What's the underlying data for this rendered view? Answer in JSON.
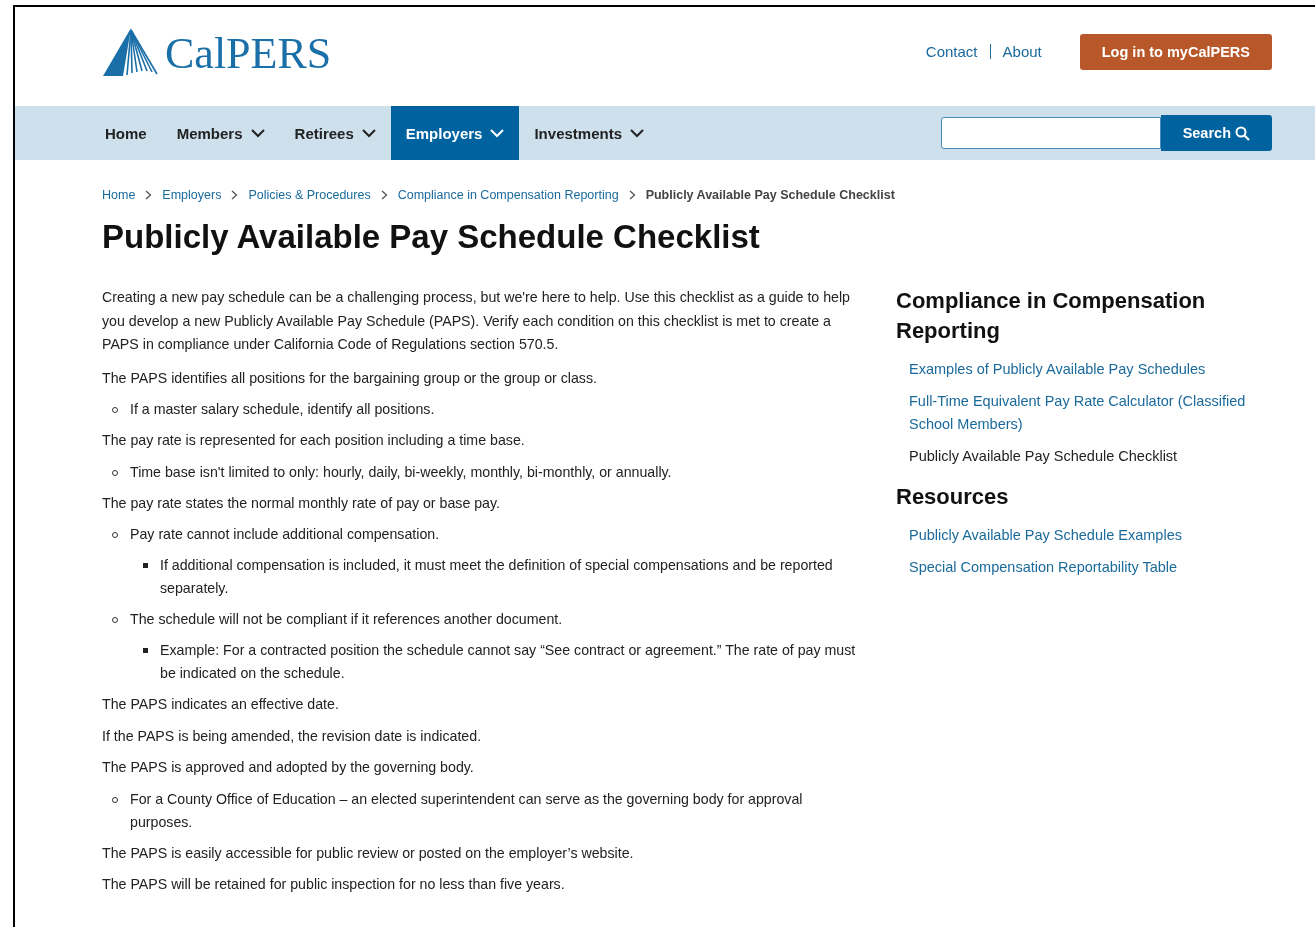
{
  "header": {
    "logo": "CalPERS",
    "links": [
      "Contact",
      "About"
    ],
    "login_button": "Log in to myCalPERS"
  },
  "nav": {
    "items": [
      {
        "label": "Home",
        "dropdown": false,
        "selected": false
      },
      {
        "label": "Members",
        "dropdown": true,
        "selected": false
      },
      {
        "label": "Retirees",
        "dropdown": true,
        "selected": false
      },
      {
        "label": "Employers",
        "dropdown": true,
        "selected": true
      },
      {
        "label": "Investments",
        "dropdown": true,
        "selected": false
      }
    ],
    "search": {
      "button": "Search"
    }
  },
  "breadcrumb": [
    "Home",
    "Employers",
    "Policies & Procedures",
    "Compliance in Compensation Reporting",
    "Publicly Available Pay Schedule Checklist"
  ],
  "title": "Publicly Available Pay Schedule Checklist",
  "intro": "Creating a new pay schedule can be a challenging process, but we're here to help. Use this checklist as a guide to help you develop a new Publicly Available Pay Schedule (PAPS). Verify each condition on this checklist is met to create a PAPS in compliance under California Code of Regulations section 570.5.",
  "checklist": [
    {
      "text": "The PAPS identifies all positions for the bargaining group or the group or class.",
      "children": [
        {
          "text": "If a master salary schedule, identify all positions."
        }
      ]
    },
    {
      "text": "The pay rate is represented for each position including a time base.",
      "children": [
        {
          "text": "Time base isn't limited to only: hourly, daily, bi-weekly, monthly, bi-monthly, or annually."
        }
      ]
    },
    {
      "text": "The pay rate states the normal monthly rate of pay or base pay.",
      "children": [
        {
          "text": "Pay rate cannot include additional compensation.",
          "children": [
            {
              "text": "If additional compensation is included, it must meet the definition of special compensations and be reported separately."
            }
          ]
        },
        {
          "text": "The schedule will not be compliant if it references another document.",
          "children": [
            {
              "text": "Example: For a contracted position the schedule cannot say “See contract or agreement.” The rate of pay must be indicated on the schedule."
            }
          ]
        }
      ]
    },
    {
      "text": "The PAPS indicates an effective date."
    },
    {
      "text": "If the PAPS is being amended, the revision date is indicated."
    },
    {
      "text": "The PAPS is approved and adopted by the governing body.",
      "children": [
        {
          "text": "For a County Office of Education – an elected superintendent can serve as the governing body for approval purposes."
        }
      ]
    },
    {
      "text": "The PAPS is easily accessible for public review or posted on the employer’s website."
    },
    {
      "text": "The PAPS will be retained for public inspection for no less than five years."
    }
  ],
  "sidebar": [
    {
      "heading": "Compliance in Compensation Reporting",
      "links": [
        {
          "label": "Examples of Publicly Available Pay Schedules",
          "selected": false
        },
        {
          "label": "Full-Time Equivalent Pay Rate Calculator (Classified School Members)",
          "selected": false
        },
        {
          "label": "Publicly Available Pay Schedule Checklist",
          "selected": true
        }
      ]
    },
    {
      "heading": "Resources",
      "links": [
        {
          "label": "Publicly Available Pay Schedule Examples",
          "selected": false
        },
        {
          "label": "Special Compensation Reportability Table",
          "selected": false
        }
      ]
    }
  ]
}
